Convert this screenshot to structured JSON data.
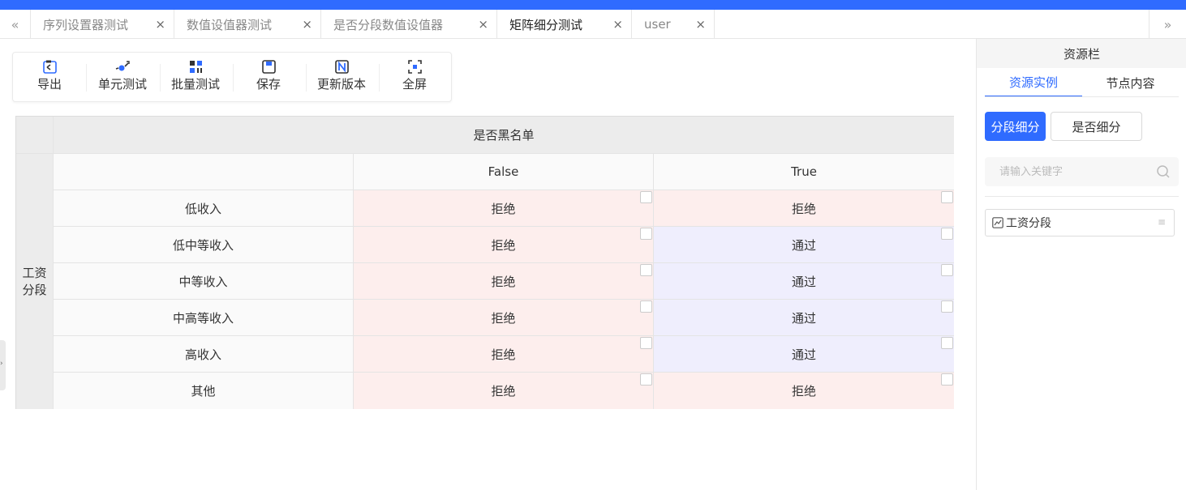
{
  "tabs": {
    "items": [
      {
        "label": "序列设置器测试",
        "active": false
      },
      {
        "label": "数值设值器测试",
        "active": false
      },
      {
        "label": "是否分段数值设值器",
        "active": false
      },
      {
        "label": "矩阵细分测试",
        "active": true
      },
      {
        "label": "user",
        "active": false
      }
    ],
    "close_glyph": "×",
    "scroll_left_glyph": "«",
    "scroll_right_glyph": "»"
  },
  "toolbar": {
    "items": [
      {
        "label": "导出",
        "icon": "export-icon"
      },
      {
        "label": "单元测试",
        "icon": "unit-test-icon"
      },
      {
        "label": "批量测试",
        "icon": "batch-test-icon"
      },
      {
        "label": "保存",
        "icon": "save-icon"
      },
      {
        "label": "更新版本",
        "icon": "update-version-icon"
      },
      {
        "label": "全屏",
        "icon": "fullscreen-icon"
      }
    ]
  },
  "matrix": {
    "column_dimension": "是否黑名单",
    "row_dimension": "工资分段",
    "columns": [
      "False",
      "True"
    ],
    "rows": [
      {
        "label": "低收入",
        "values": [
          "拒绝",
          "拒绝"
        ]
      },
      {
        "label": "低中等收入",
        "values": [
          "拒绝",
          "通过"
        ]
      },
      {
        "label": "中等收入",
        "values": [
          "拒绝",
          "通过"
        ]
      },
      {
        "label": "中高等收入",
        "values": [
          "拒绝",
          "通过"
        ]
      },
      {
        "label": "高收入",
        "values": [
          "拒绝",
          "通过"
        ]
      },
      {
        "label": "其他",
        "values": [
          "拒绝",
          "拒绝"
        ]
      }
    ],
    "colors": {
      "deny": "#fdeeed",
      "pass": "#efeefd"
    }
  },
  "panel": {
    "title": "资源栏",
    "tabs": [
      {
        "label": "资源实例",
        "active": true
      },
      {
        "label": "节点内容",
        "active": false
      }
    ],
    "segment_button": "分段细分",
    "yesno_button": "是否细分",
    "search_placeholder": "请输入关键字",
    "resources": [
      {
        "label": "工资分段",
        "icon": "chart-icon"
      }
    ],
    "accent": "#2f6bff"
  }
}
